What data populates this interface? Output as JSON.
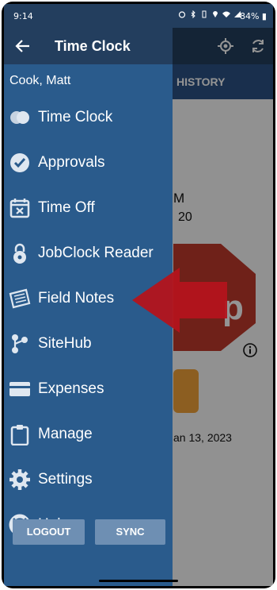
{
  "status_bar": {
    "time": "9:14",
    "battery": "84%"
  },
  "drawer": {
    "title": "Time Clock",
    "user": "Cook, Matt",
    "items": [
      {
        "label": "Time Clock",
        "icon": "toggle-circles-icon"
      },
      {
        "label": "Approvals",
        "icon": "check-circle-icon"
      },
      {
        "label": "Time Off",
        "icon": "calendar-x-icon"
      },
      {
        "label": "JobClock Reader",
        "icon": "padlock-icon"
      },
      {
        "label": "Field Notes",
        "icon": "notepad-icon"
      },
      {
        "label": "SiteHub",
        "icon": "share-nodes-icon"
      },
      {
        "label": "Expenses",
        "icon": "credit-card-icon"
      },
      {
        "label": "Manage",
        "icon": "clipboard-icon"
      },
      {
        "label": "Settings",
        "icon": "gear-icon"
      },
      {
        "label": "Help",
        "icon": "lifebuoy-icon"
      }
    ],
    "logout_label": "LOGOUT",
    "sync_label": "SYNC"
  },
  "background": {
    "tab_history": "HISTORY",
    "text_m": "M",
    "text_20": "20",
    "stop_letter": "p",
    "date_text": "an 13, 2023"
  },
  "colors": {
    "drawer_bg": "#2a5b8c",
    "header_bg": "#233e5e",
    "button_bg": "#6e8fb3",
    "arrow_red": "#b3141c",
    "stop_red": "#c0392b"
  }
}
